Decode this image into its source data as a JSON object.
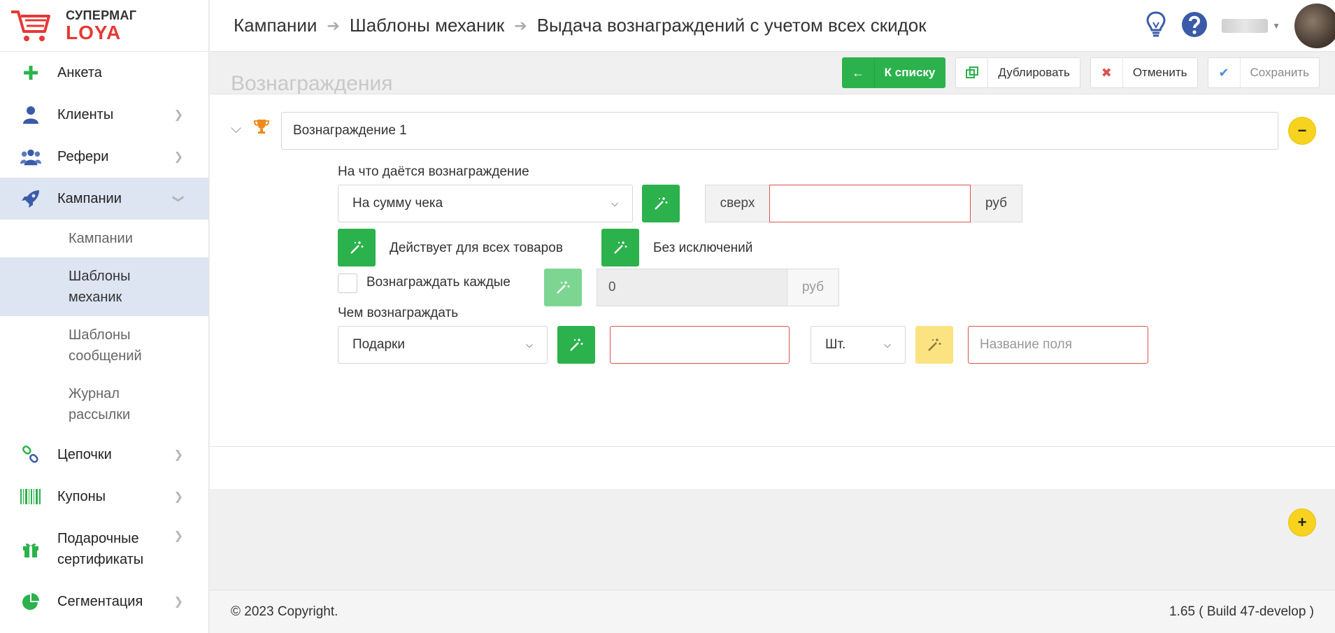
{
  "logo": {
    "line1": "СУПЕРМАГ",
    "line2": "LOYA"
  },
  "sidebar": {
    "items": [
      {
        "label": "Анкета",
        "icon": "plus-icon"
      },
      {
        "label": "Клиенты",
        "icon": "user-icon"
      },
      {
        "label": "Рефери",
        "icon": "users-icon"
      },
      {
        "label": "Кампании",
        "icon": "rocket-icon"
      },
      {
        "label": "Цепочки",
        "icon": "link-icon"
      },
      {
        "label": "Купоны",
        "icon": "barcode-icon"
      },
      {
        "label": "Подарочные сертификаты",
        "label_line1": "Подарочные",
        "label_line2": "сертификаты",
        "icon": "gift-icon"
      },
      {
        "label": "Сегментация",
        "icon": "pie-chart-icon"
      }
    ],
    "subitems": [
      {
        "label": "Кампании"
      },
      {
        "label": "Шаблоны механик",
        "l1": "Шаблоны",
        "l2": "механик"
      },
      {
        "label": "Шаблоны сообщений",
        "l1": "Шаблоны",
        "l2": "сообщений"
      },
      {
        "label": "Журнал рассылки",
        "l1": "Журнал",
        "l2": "рассылки"
      }
    ]
  },
  "breadcrumb": [
    "Кампании",
    "Шаблоны механик",
    "Выдача вознаграждений с учетом всех скидок"
  ],
  "page_section_title": "Вознаграждения",
  "toolbar": {
    "back_label": "К списку",
    "duplicate_label": "Дублировать",
    "cancel_label": "Отменить",
    "save_label": "Сохранить"
  },
  "reward": {
    "name_value": "Вознаграждение 1",
    "for_what_label": "На что даётся вознаграждение",
    "for_what_value": "На сумму чека",
    "over_label": "сверх",
    "over_value": "",
    "currency": "руб",
    "applies_label": "Действует для всех товаров",
    "exceptions_label": "Без исключений",
    "every_label": "Вознаграждать каждые",
    "every_value": "0",
    "every_currency": "руб",
    "with_what_label": "Чем вознаграждать",
    "with_what_value": "Подарки",
    "qty_value": "",
    "unit_value": "Шт.",
    "field_name_placeholder": "Название поля"
  },
  "footer": {
    "copyright": "© 2023 Copyright.",
    "version": "1.65 ( Build 47-develop )"
  },
  "colors": {
    "accent_green": "#2bb24c",
    "accent_yellow": "#f7d31f",
    "error_red": "#d9534f",
    "active_nav": "#dde4f2",
    "brand_red": "#e53935"
  }
}
